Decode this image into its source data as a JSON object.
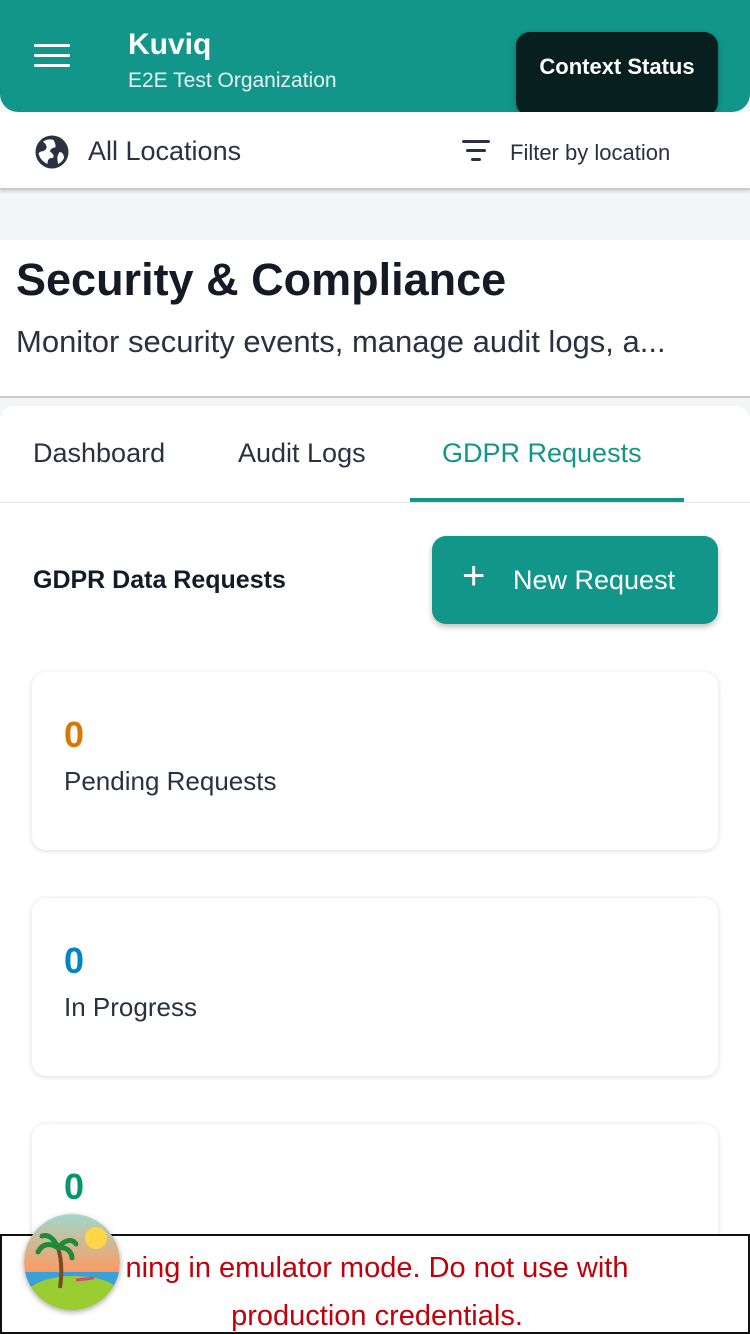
{
  "header": {
    "menu_icon": "hamburger-icon",
    "app_name": "Kuviq",
    "org_name": "E2E Test Organization",
    "context_status": "Context Status",
    "brand_color": "#12968a"
  },
  "location_bar": {
    "globe_icon": "globe-icon",
    "location_label": "All Locations",
    "filter_icon": "filter-icon",
    "filter_label": "Filter by location"
  },
  "page": {
    "title": "Security & Compliance",
    "description": "Monitor security events, manage audit logs, a..."
  },
  "tabs": [
    {
      "label": "Dashboard",
      "active": false
    },
    {
      "label": "Audit Logs",
      "active": false
    },
    {
      "label": "GDPR Requests",
      "active": true
    }
  ],
  "gdpr": {
    "section_title": "GDPR Data Requests",
    "new_request_label": "New Request",
    "stats": [
      {
        "value": "0",
        "label": "Pending Requests",
        "color": "#d97706"
      },
      {
        "value": "0",
        "label": "In Progress",
        "color": "#0284c7"
      },
      {
        "value": "0",
        "label": "",
        "color": "#059669"
      }
    ]
  },
  "emulator_banner": {
    "line1": "ning in emulator mode. Do not use with",
    "line2": "production credentials.",
    "color": "#c0000a"
  }
}
